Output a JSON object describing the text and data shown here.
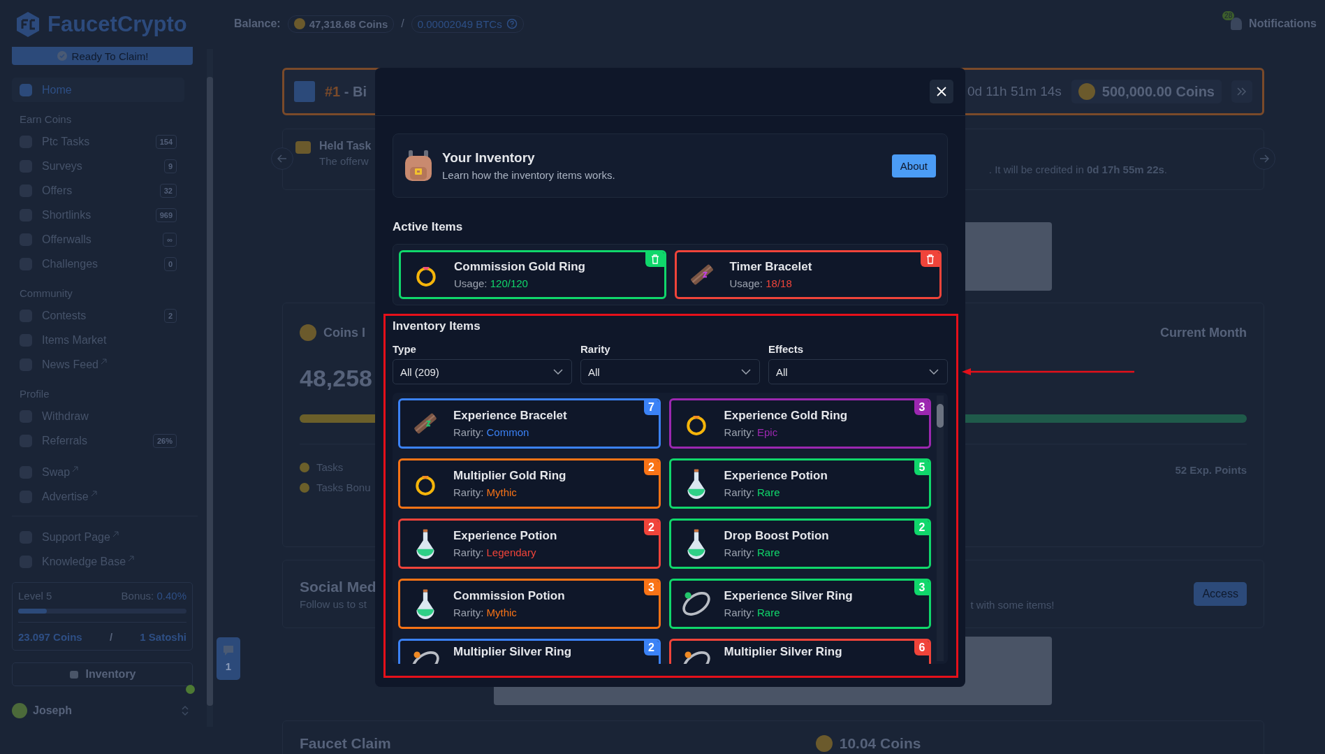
{
  "sidebar": {
    "logo": "FaucetCrypto",
    "claim_button": "Ready To Claim!",
    "groups": [
      {
        "items": [
          {
            "label": "Home",
            "selected": true,
            "external": false
          }
        ]
      },
      {
        "heading": "Earn Coins",
        "items": [
          {
            "label": "Ptc Tasks",
            "badge": "154",
            "selected": false,
            "external": false
          },
          {
            "label": "Surveys",
            "badge": "9",
            "selected": false,
            "external": false
          },
          {
            "label": "Offers",
            "badge": "32",
            "selected": false,
            "external": false
          },
          {
            "label": "Shortlinks",
            "badge": "969",
            "selected": false,
            "external": false
          },
          {
            "label": "Offerwalls",
            "badge": "∞",
            "selected": false,
            "external": false
          },
          {
            "label": "Challenges",
            "badge": "0",
            "selected": false,
            "external": false
          }
        ]
      },
      {
        "heading": "Community",
        "items": [
          {
            "label": "Contests",
            "badge": "2",
            "selected": false,
            "external": false
          },
          {
            "label": "Items Market",
            "selected": false,
            "external": false
          },
          {
            "label": "News Feed",
            "selected": false,
            "external": true
          }
        ]
      },
      {
        "heading": "Profile",
        "items": [
          {
            "label": "Withdraw",
            "selected": false,
            "external": false
          },
          {
            "label": "Referrals",
            "badge": "26%",
            "selected": false,
            "external": false
          }
        ]
      },
      {
        "items": [
          {
            "label": "Swap",
            "selected": false,
            "external": true
          },
          {
            "label": "Advertise",
            "selected": false,
            "external": true
          }
        ]
      },
      {
        "items": [
          {
            "label": "Support Page",
            "selected": false,
            "external": true
          },
          {
            "label": "Knowledge Base",
            "selected": false,
            "external": true
          }
        ]
      }
    ],
    "level_card": {
      "level_label": "Level 5",
      "bonus_label": "Bonus:",
      "bonus": "0.40%",
      "level": 0.17,
      "coins": "23.097 Coins",
      "separator": "/",
      "satoshi": "1 Satoshi"
    },
    "inventory_button": "Inventory",
    "user": "Joseph"
  },
  "topbar": {
    "balance_label": "Balance:",
    "coins": "47,318.68 Coins",
    "separator": "/",
    "btc": "0.00002049 BTCs",
    "notification_count": "28",
    "notifications": "Notifications"
  },
  "background": {
    "contest": {
      "rank": "#1",
      "title": "- Bi",
      "timer": "0d 11h 51m 14s",
      "prize": "500,000.00 Coins"
    },
    "held_task": {
      "title": "Held Task",
      "text_start": "The offerw",
      "text_end": ". It will be credited in **0d 17h 55m 22s**."
    },
    "coins_card": {
      "title": "Coins I",
      "amount": "48,258",
      "period": "Current Month",
      "legend": [
        "Tasks",
        "Tasks Bonu"
      ],
      "level": 0.3,
      "points": "52 Exp. Points"
    },
    "social": {
      "title": "Social Med",
      "text_start": "Follow us to st",
      "text_end": "t with some items!",
      "button": "Access"
    },
    "faucet": {
      "title": "Faucet Claim",
      "amount": "10.04 Coins"
    },
    "chat_count": "1"
  },
  "modal": {
    "header": {
      "title": "Your Inventory",
      "subtitle": "Learn how the inventory items works.",
      "button": "About"
    },
    "active_title": "Active Items",
    "active_items": [
      {
        "name": "Commission Gold Ring",
        "kind": "gold-ring",
        "usage_label": "Usage:",
        "usage": "120/120",
        "color": "#10d76b"
      },
      {
        "name": "Timer Bracelet",
        "kind": "bracelet",
        "usage_label": "Usage:",
        "usage": "18/18",
        "color": "#f0443a"
      }
    ],
    "inventory_title": "Inventory Items",
    "filters": [
      {
        "label": "Type",
        "value": "All (209)"
      },
      {
        "label": "Rarity",
        "value": "All"
      },
      {
        "label": "Effects",
        "value": "All"
      }
    ],
    "items": [
      {
        "name": "Experience Bracelet",
        "kind": "bracelet",
        "rarity_label": "Rarity:",
        "rarity": "Common",
        "count": "7",
        "color": "#3b82f6"
      },
      {
        "name": "Experience Gold Ring",
        "kind": "gold-ring",
        "rarity_label": "Rarity:",
        "rarity": "Epic",
        "count": "3",
        "color": "#9c27b0"
      },
      {
        "name": "Multiplier Gold Ring",
        "kind": "gold-ring",
        "rarity_label": "Rarity:",
        "rarity": "Mythic",
        "count": "2",
        "color": "#f97316"
      },
      {
        "name": "Experience Potion",
        "kind": "potion",
        "rarity_label": "Rarity:",
        "rarity": "Rare",
        "count": "5",
        "color": "#10d76b"
      },
      {
        "name": "Experience Potion",
        "kind": "potion",
        "rarity_label": "Rarity:",
        "rarity": "Legendary",
        "count": "2",
        "color": "#f0443a"
      },
      {
        "name": "Drop Boost Potion",
        "kind": "potion",
        "rarity_label": "Rarity:",
        "rarity": "Rare",
        "count": "2",
        "color": "#10d76b"
      },
      {
        "name": "Commission Potion",
        "kind": "potion",
        "rarity_label": "Rarity:",
        "rarity": "Mythic",
        "count": "3",
        "color": "#f97316"
      },
      {
        "name": "Experience Silver Ring",
        "kind": "silver-ring",
        "rarity_label": "Rarity:",
        "rarity": "Rare",
        "count": "3",
        "color": "#10d76b"
      },
      {
        "name": "Multiplier Silver Ring",
        "kind": "silver-ring",
        "count": "2",
        "color": "#3b82f6"
      },
      {
        "name": "Multiplier Silver Ring",
        "kind": "silver-ring",
        "count": "6",
        "color": "#f0443a"
      }
    ]
  }
}
